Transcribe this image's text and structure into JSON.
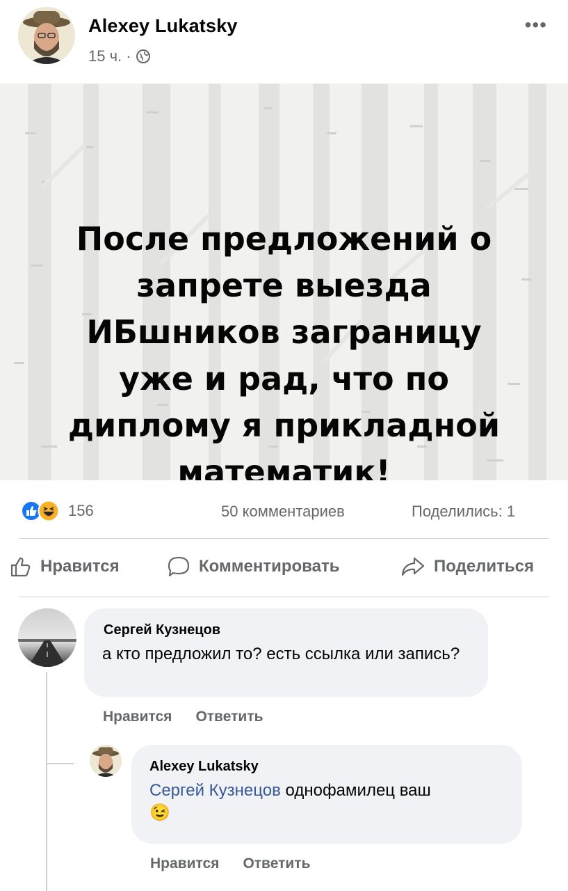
{
  "post": {
    "author": "Alexey Lukatsky",
    "time": "15 ч. ·",
    "more_label": "•••",
    "image_text": "После предложений о\nзапрете выезда\nИБшников заграницу\nуже и рад, что по\nдиплому я прикладной\nматематик!",
    "reaction_count": "156",
    "comments_count": "50 комментариев",
    "shares_count": "Поделились: 1"
  },
  "actions": {
    "like": "Нравится",
    "comment": "Комментировать",
    "share": "Поделиться"
  },
  "comments": [
    {
      "author": "Сергей Кузнецов",
      "text": "а кто предложил то? есть ссылка или запись?",
      "like": "Нравится",
      "reply": "Ответить"
    },
    {
      "author": "Alexey Lukatsky",
      "mention": "Сергей Кузнецов",
      "text": " однофамилец ваш",
      "emoji": "😉",
      "like": "Нравится",
      "reply": "Ответить"
    }
  ],
  "icons": {
    "privacy": "globe-icon",
    "reactions": [
      "like-reaction-icon",
      "haha-reaction-icon"
    ]
  },
  "colors": {
    "like_blue": "#1877f2",
    "haha_yellow": "#f7b125",
    "muted": "#65676b",
    "mention": "#385898",
    "bubble": "#f0f2f5"
  }
}
